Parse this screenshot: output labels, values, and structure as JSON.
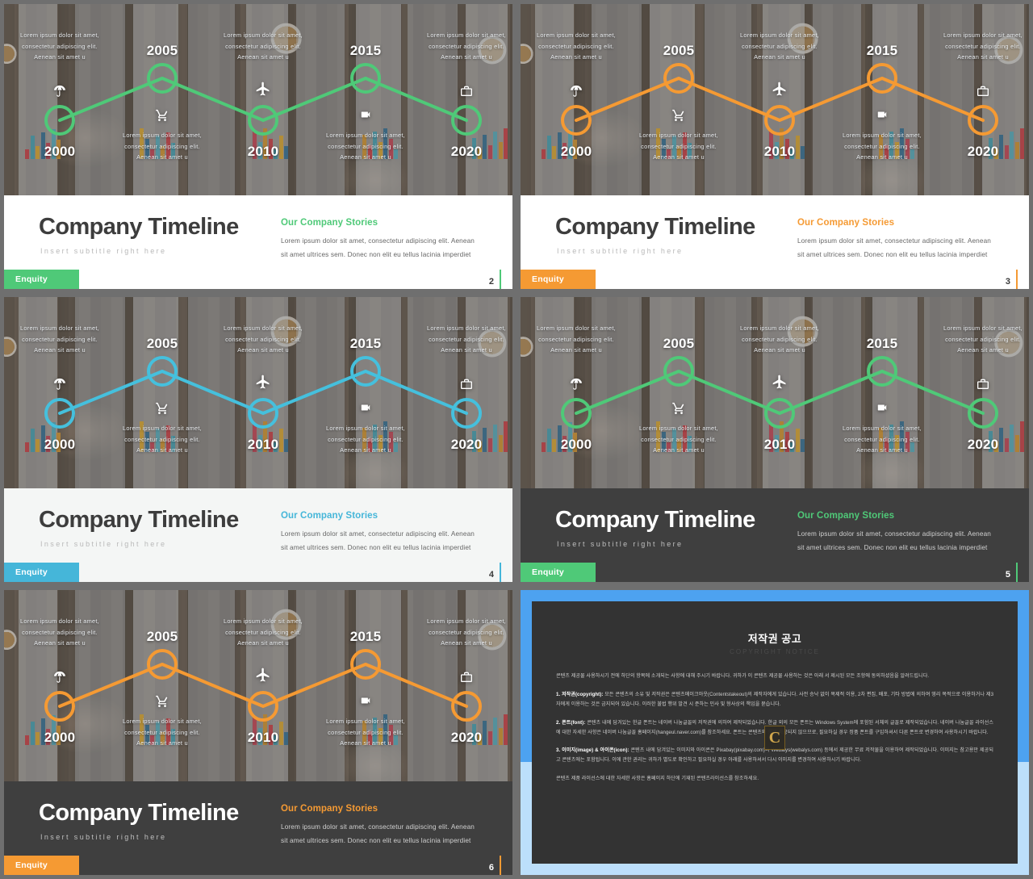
{
  "deck": {
    "slide_common": {
      "title": "Company Timeline",
      "subtitle": "Insert  subtitle  right  here",
      "story_heading": "Our Company Stories",
      "story_body": "Lorem ipsum dolor sit amet, consectetur adipiscing elit. Aenean sit amet ultrices sem. Donec non elit eu tellus lacinia imperdiet",
      "enquiry_label": "Enquity",
      "blurb": "Lorem ipsum dolor sit amet, consectetur adipiscing elit. Aenean sit amet u",
      "years": [
        "2000",
        "2005",
        "2010",
        "2015",
        "2020"
      ],
      "icons": [
        "umbrella-icon",
        "cart-icon",
        "airplane-icon",
        "video-camera-icon",
        "briefcase-icon"
      ]
    },
    "slides": [
      {
        "page": "2",
        "accent": "#4fc978",
        "band": "white",
        "line": "#4fc978"
      },
      {
        "page": "3",
        "accent": "#f59a33",
        "band": "white",
        "line": "#f59a33"
      },
      {
        "page": "4",
        "accent": "#45b6d9",
        "band": "light",
        "line": "#45c0dd"
      },
      {
        "page": "5",
        "accent": "#4fc978",
        "band": "dark",
        "line": "#4fc978"
      },
      {
        "page": "6",
        "accent": "#f59a33",
        "band": "dark",
        "line": "#f59a33"
      }
    ],
    "copyright": {
      "title": "저작권 공고",
      "subtitle": "COPYRIGHT NOTICE",
      "logo_letter": "C",
      "intro": "콘텐츠 제공물 사용하시기 전에 하단의 항목에 소개되는 사항에 대해 주시기 바랍니다. 귀하가 이 콘텐츠 제공물 사용하는 것은 아래 서 제시된 모든 조항에 동의하셨음을 알려드립니다.",
      "sections": [
        {
          "label": "1. 저작권(copyright):",
          "text": "모든 콘텐츠의 소유 및 저작권은 콘텐츠메이크아웃(Contentstakeout)의 제작자에게 있습니다. 사전 승낙 없이 복제적 이용, 2차 편집, 배포, 기타 방법에 의하여 영리 목적으로 이용하거나 제3자에게 이용하는 것은 금지되어 있습니다. 이러한 불법 행위 발견 시 준하는 민사 및 형사상의 책임을 묻습니다."
        },
        {
          "label": "2. 폰트(font):",
          "text": "콘텐츠 내에 담겨있는 한글 폰트는 네이버 나눔글꼴의 저작권에 의하여 제작되었습니다. 한글 외의 모든 폰트는 Windows System에 포함된 서체의 글꼴로 제작되었습니다. 네이버 나눔글꼴 라이선스에 대한 자세한 사항은 네이버 나눔글꼴 홈페이지(hangeul.naver.com)를 참조하세요. 폰트는 콘텐츠와 함께 제공되지 않으므로, 필요하실 경우 정품 폰트를 구입하셔서 다른 폰트로 변경하여 사용하시기 바랍니다."
        },
        {
          "label": "3. 이미지(image) & 아이콘(icon):",
          "text": "콘텐츠 내에 담겨있는 이미지와 아이콘은 Pixabay(pixabay.com)와 Webalys(webalys.com) 등에서 제공한 무료 저작물을 이용하여 제작되었습니다. 이미지는 참고용만 제공되고 콘텐츠에는 포함됩니다. 이에 관한 권리는 귀하가 별도로 확인하고 필요하실 경우 아래를 사용하셔서 다시 이미지를 변경하여 사용하시기 바랍니다."
        }
      ],
      "footer": "콘텐츠 제품 라이선스에 대한 자세한 사항은 홈페이지 하단에 기재된 콘텐츠라이선스를 참조하세요."
    }
  }
}
